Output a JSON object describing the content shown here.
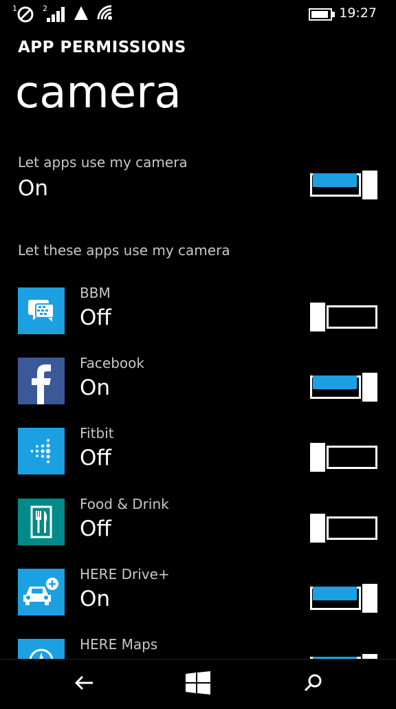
{
  "status_bar": {
    "sim1": "1",
    "sim2": "2",
    "time": "19:27"
  },
  "header": {
    "kicker": "APP PERMISSIONS",
    "title": "camera"
  },
  "master": {
    "label": "Let apps use my camera",
    "value": "On",
    "on": true
  },
  "section_label": "Let these apps use my camera",
  "apps": [
    {
      "name": "BBM",
      "state": "Off",
      "on": false,
      "tile_color": "#1ba1e2",
      "icon": "bbm-icon"
    },
    {
      "name": "Facebook",
      "state": "On",
      "on": true,
      "tile_color": "#3b5998",
      "icon": "facebook-icon"
    },
    {
      "name": "Fitbit",
      "state": "Off",
      "on": false,
      "tile_color": "#1ba1e2",
      "icon": "fitbit-icon"
    },
    {
      "name": "Food & Drink",
      "state": "Off",
      "on": false,
      "tile_color": "#008a8a",
      "icon": "food-drink-icon"
    },
    {
      "name": "HERE Drive+",
      "state": "On",
      "on": true,
      "tile_color": "#1ba1e2",
      "icon": "here-drive-icon"
    },
    {
      "name": "HERE Maps",
      "state": "",
      "on": true,
      "tile_color": "#1ba1e2",
      "icon": "here-maps-icon"
    }
  ],
  "accent_color": "#1ba1e2"
}
